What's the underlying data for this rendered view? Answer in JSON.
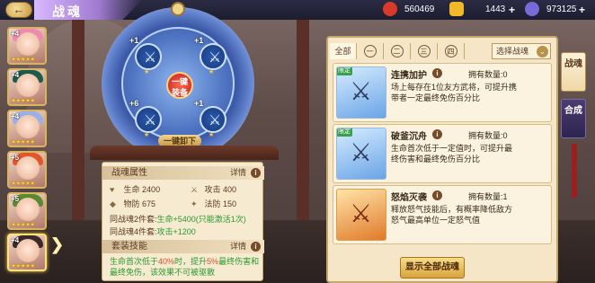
{
  "header": {
    "title": "战魂",
    "currencies": [
      {
        "icon": "gourd-icon",
        "value": "560469",
        "color": "#d83a2a"
      },
      {
        "icon": "gold-ingot-icon",
        "value": "1443",
        "color": "#f2b82a"
      },
      {
        "icon": "gem-icon",
        "value": "973125",
        "color": "#7a6ad8"
      }
    ]
  },
  "heroes": [
    {
      "level": "+4",
      "hair": "#f08ab0",
      "stars": "★★★★★"
    },
    {
      "level": "+4",
      "hair": "#1e5a4a",
      "stars": "★★★★★"
    },
    {
      "level": "+4",
      "hair": "#9ab0e8",
      "stars": "★★★★★"
    },
    {
      "level": "+5",
      "hair": "#e0582a",
      "stars": "★★★★★"
    },
    {
      "level": "+5",
      "hair": "#5a8a30",
      "stars": "★★★★★"
    },
    {
      "level": "+4",
      "hair": "#3a2a2a",
      "stars": "★★★★★"
    }
  ],
  "ring": {
    "slots": [
      {
        "plus": "+1"
      },
      {
        "plus": "+1"
      },
      {
        "plus": "+6"
      },
      {
        "plus": "+1"
      }
    ],
    "equip_label": "一键装备",
    "unload_label": "一键卸下"
  },
  "stats_panel": {
    "attr_title": "战魂属性",
    "detail_label": "详情",
    "stats": [
      {
        "icon": "heart-icon",
        "label": "生命",
        "value": "2400"
      },
      {
        "icon": "sword-icon",
        "label": "攻击",
        "value": "400"
      },
      {
        "icon": "shield-icon",
        "label": "物防",
        "value": "675"
      },
      {
        "icon": "magic-icon",
        "label": "法防",
        "value": "150"
      }
    ],
    "set2_label": "同战魂2件套:",
    "set2_value": "生命+5400(只能激活1次)",
    "set4_label": "同战魂4件套:",
    "set4_value": "攻击+1200",
    "skill_title": "套装技能",
    "skill_desc_a": "生命首次低于",
    "skill_desc_b": "40%",
    "skill_desc_c": "时，提升",
    "skill_desc_d": "5%",
    "skill_desc_e": "最终伤害和最终免伤，该效果不可被驱散"
  },
  "panel": {
    "tabs": [
      "全部",
      "一",
      "二",
      "三",
      "四"
    ],
    "select_label": "选择战魂",
    "cards": [
      {
        "name": "连携加护",
        "count": "拥有数量:0",
        "desc": "场上每存在1位友方武将，可提升携带者一定最终免伤百分比",
        "type": "ice"
      },
      {
        "name": "破釜沉舟",
        "count": "拥有数量:0",
        "desc": "生命首次低于一定值时，可提升最终伤害和最终免伤百分比",
        "type": "ice"
      },
      {
        "name": "怒焰灭袭",
        "count": "拥有数量:1",
        "desc": "释放怒气技能后，有概率降低敌方怒气最高单位一定怒气值",
        "type": "fire"
      }
    ],
    "show_all_label": "显示全部战魂",
    "badge_label": "限定"
  },
  "side_tabs": [
    {
      "label": "战魂",
      "active": true
    },
    {
      "label": "合成",
      "active": false
    }
  ]
}
